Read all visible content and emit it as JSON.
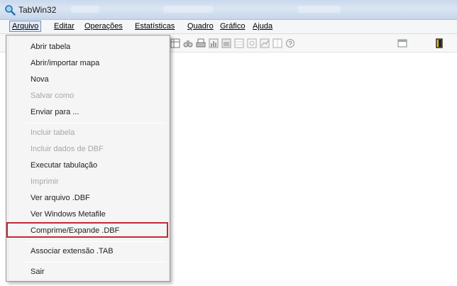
{
  "window": {
    "title": "TabWin32"
  },
  "menubar": {
    "items": [
      {
        "label": "Arquivo"
      },
      {
        "label": "Editar"
      },
      {
        "label": "Operações"
      },
      {
        "label": "Estatísticas"
      },
      {
        "label": "Quadro"
      },
      {
        "label": "Gráfico"
      },
      {
        "label": "Ajuda"
      }
    ]
  },
  "toolbar": {
    "icons": [
      "table-icon",
      "binoculars-icon",
      "print-icon",
      "chart-icon",
      "chart-icon",
      "grid-icon",
      "grid-icon",
      "chart-icon",
      "grid-icon",
      "help-icon",
      "window-icon",
      "exit-icon"
    ]
  },
  "arquivo_menu": {
    "items": [
      {
        "label": "Abrir tabela",
        "enabled": true
      },
      {
        "label": "Abrir/importar mapa",
        "enabled": true
      },
      {
        "label": "Nova",
        "enabled": true
      },
      {
        "label": "Salvar como",
        "enabled": false
      },
      {
        "label": "Enviar para ...",
        "enabled": true
      },
      {
        "label": "Incluir tabela",
        "enabled": false
      },
      {
        "label": "Incluir dados de DBF",
        "enabled": false
      },
      {
        "label": "Executar tabulação",
        "enabled": true
      },
      {
        "label": "Imprimir",
        "enabled": false
      },
      {
        "label": "Ver arquivo .DBF",
        "enabled": true
      },
      {
        "label": "Ver Windows Metafile",
        "enabled": true
      },
      {
        "label": "Comprime/Expande .DBF",
        "enabled": true,
        "highlighted": true
      },
      {
        "label": "Associar extensão .TAB",
        "enabled": true
      },
      {
        "label": "Sair",
        "enabled": true
      }
    ],
    "highlight_color": "#c22a36"
  }
}
